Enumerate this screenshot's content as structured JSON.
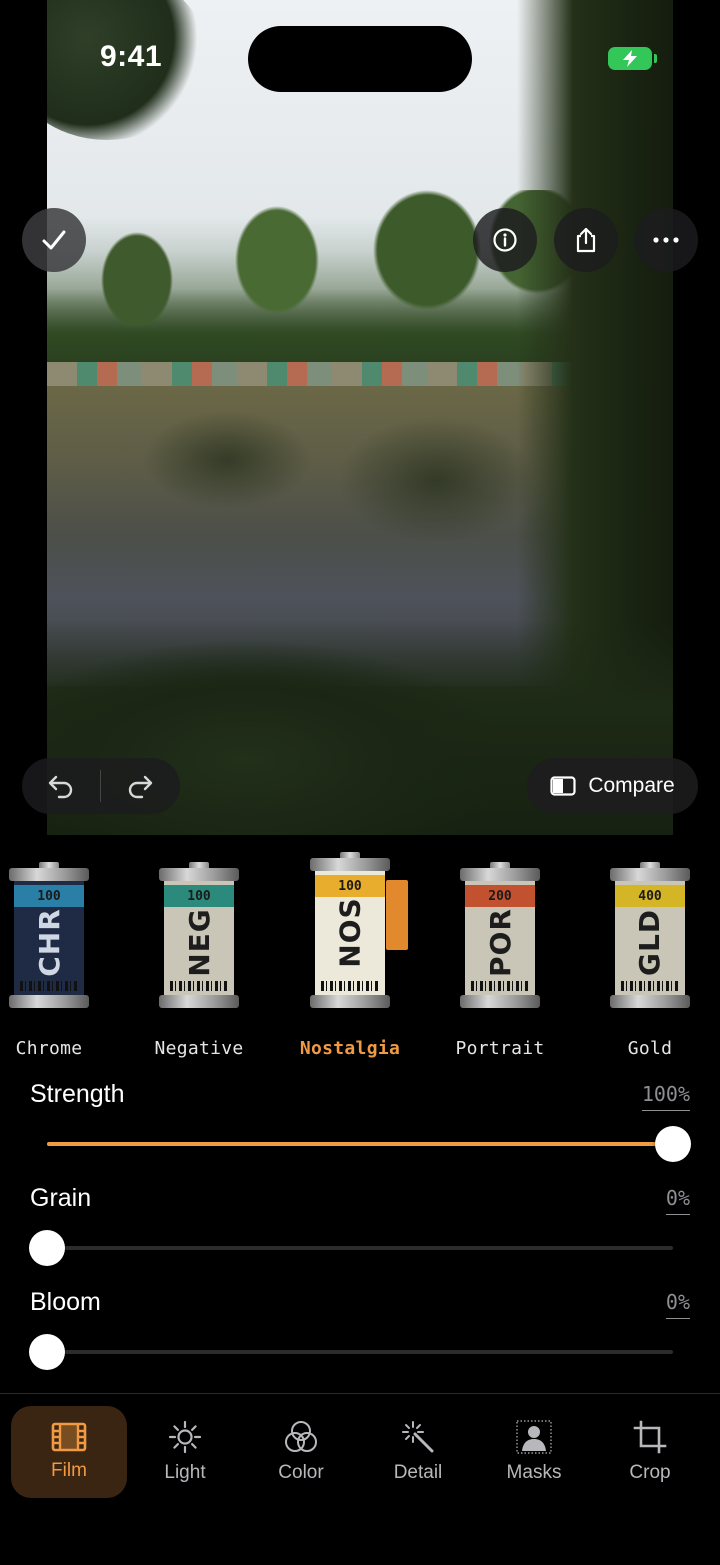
{
  "status": {
    "time": "9:41"
  },
  "rolls": [
    {
      "label": "Chrome",
      "iso": "100",
      "code": "CHR",
      "band": "#2a7fa6",
      "body": "#1f2a44",
      "codeColor": "#cfd6e4",
      "active": false
    },
    {
      "label": "Negative",
      "iso": "100",
      "code": "NEG",
      "band": "#2b8a7c",
      "body": "#c9c5b7",
      "codeColor": "#1d1d1d",
      "active": false
    },
    {
      "label": "Nostalgia",
      "iso": "100",
      "code": "NOS",
      "band": "#e8ad2c",
      "body": "#ece8da",
      "codeColor": "#1d1d1d",
      "active": true
    },
    {
      "label": "Portrait",
      "iso": "200",
      "code": "POR",
      "band": "#c2522f",
      "body": "#c9c5b7",
      "codeColor": "#1d1d1d",
      "active": false
    },
    {
      "label": "Gold",
      "iso": "400",
      "code": "GLD",
      "band": "#d4b526",
      "body": "#c9c5b7",
      "codeColor": "#1d1d1d",
      "active": false
    }
  ],
  "controls": {
    "compare_label": "Compare"
  },
  "sliders": [
    {
      "name": "Strength",
      "value": "100%",
      "level": 1.0
    },
    {
      "name": "Grain",
      "value": "0%",
      "level": 0.0
    },
    {
      "name": "Bloom",
      "value": "0%",
      "level": 0.0
    }
  ],
  "tabs": [
    {
      "label": "Film",
      "icon": "film-icon",
      "active": true
    },
    {
      "label": "Light",
      "icon": "sun-icon",
      "active": false
    },
    {
      "label": "Color",
      "icon": "color-circles-icon",
      "active": false
    },
    {
      "label": "Detail",
      "icon": "magic-wand-icon",
      "active": false
    },
    {
      "label": "Masks",
      "icon": "person-mask-icon",
      "active": false
    },
    {
      "label": "Crop",
      "icon": "crop-icon",
      "active": false
    }
  ],
  "colors": {
    "accent": "#f09a43",
    "background": "#000000"
  }
}
